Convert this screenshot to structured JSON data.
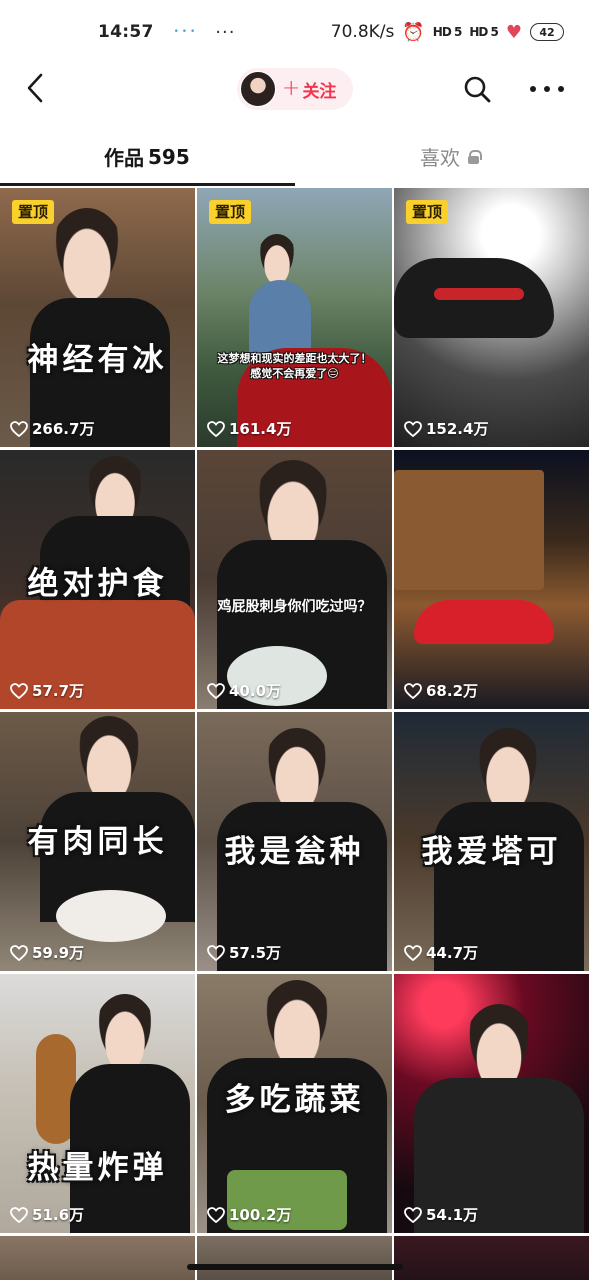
{
  "status_bar": {
    "time": "14:57",
    "indicators": "•  •  •",
    "more": "···",
    "net_speed": "70.8K/s",
    "alarm_icon": "alarm-icon",
    "signal_1": "HD 5",
    "signal_2": "HD 5",
    "battery": "42"
  },
  "header": {
    "back_icon": "chevron-left-icon",
    "follow_plus": "+",
    "follow_label": "关注",
    "search_icon": "search-icon",
    "more_icon": "more-horizontal-icon"
  },
  "tabs": {
    "works_label": "作品",
    "works_count": "595",
    "likes_label": "喜欢",
    "likes_lock_icon": "lock-icon"
  },
  "videos": [
    {
      "pinned": "置顶",
      "likes": "266.7万",
      "caption": "神经有冰"
    },
    {
      "pinned": "置顶",
      "likes": "161.4万",
      "caption": "这梦想和现实的差距也太大了！ 感觉不会再爱了😑"
    },
    {
      "pinned": "置顶",
      "likes": "152.4万",
      "caption": ""
    },
    {
      "pinned": "",
      "likes": "57.7万",
      "caption": "绝对护食"
    },
    {
      "pinned": "",
      "likes": "40.0万",
      "caption": "鸡屁股刺身你们吃过吗？"
    },
    {
      "pinned": "",
      "likes": "68.2万",
      "caption": ""
    },
    {
      "pinned": "",
      "likes": "59.9万",
      "caption": "有肉同长"
    },
    {
      "pinned": "",
      "likes": "57.5万",
      "caption": "我是瓮种"
    },
    {
      "pinned": "",
      "likes": "44.7万",
      "caption": "我爱塔可"
    },
    {
      "pinned": "",
      "likes": "51.6万",
      "caption": "热量炸弹"
    },
    {
      "pinned": "",
      "likes": "100.2万",
      "caption": "多吃蔬菜"
    },
    {
      "pinned": "",
      "likes": "54.1万",
      "caption": ""
    }
  ],
  "colors": {
    "accent": "#f2354f",
    "follow_bg": "#fdeef1",
    "pin_bg": "#fad02c"
  }
}
